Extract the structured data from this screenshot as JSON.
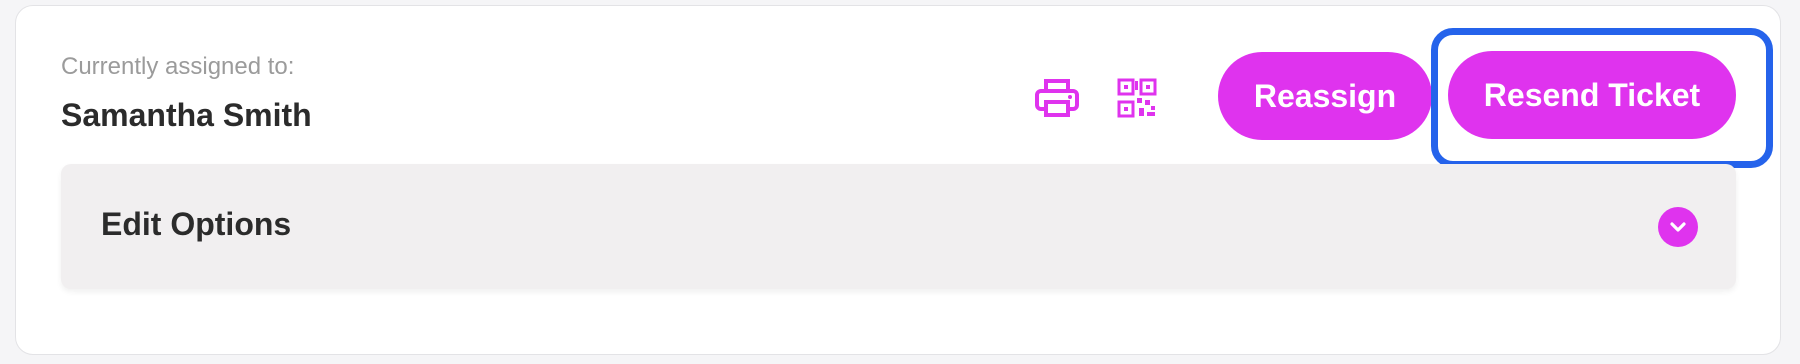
{
  "assignment": {
    "label": "Currently assigned to:",
    "name": "Samantha Smith"
  },
  "actions": {
    "print_icon": "printer-icon",
    "qr_icon": "qr-code-icon",
    "reassign_label": "Reassign",
    "resend_label": "Resend Ticket"
  },
  "edit_options": {
    "title": "Edit Options",
    "toggle_icon": "chevron-down-icon",
    "expanded": false
  },
  "colors": {
    "accent": "#df33ee",
    "highlight": "#2563eb",
    "panel_bg": "#f1eff0"
  }
}
